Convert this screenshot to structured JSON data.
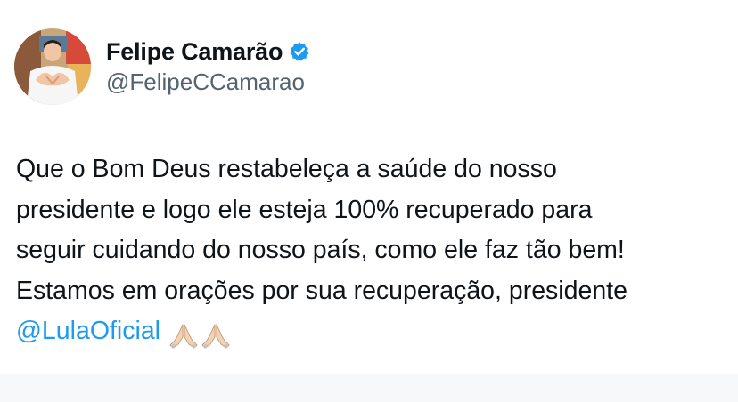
{
  "tweet": {
    "author": {
      "display_name": "Felipe Camarão",
      "handle": "@FelipeCCamarao",
      "verified_icon": "verified-badge-icon",
      "avatar_icon": "profile-photo"
    },
    "text": {
      "line1": "Que o Bom Deus restabeleça a saúde do nosso",
      "line2": "presidente e logo ele esteja 100% recuperado para",
      "line3": "seguir cuidando do nosso país, como ele faz tão bem!",
      "line4": "Estamos em orações por sua recuperação, presidente",
      "mention": "@LulaOficial",
      "emojis": [
        "folded-hands-icon",
        "folded-hands-icon"
      ]
    }
  },
  "colors": {
    "mention": "#1d9bf0",
    "verified": "#1d9bf0",
    "handle": "#536471",
    "text": "#0f1419",
    "footer": "#f7f8f9"
  }
}
